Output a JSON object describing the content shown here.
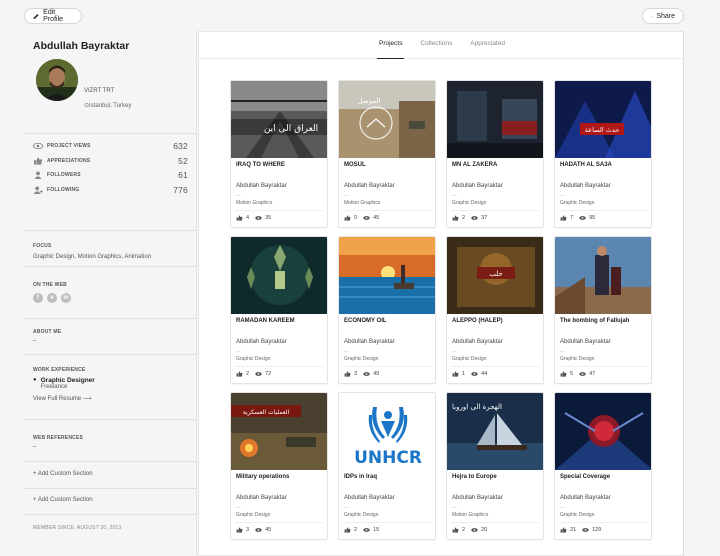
{
  "header": {
    "edit_label": "Edit Profile",
    "share_label": "Share"
  },
  "profile": {
    "name": "Abdullah Bayraktar",
    "organization": "VIZRT TRT",
    "location": "Istanbul, Turkey",
    "stats": [
      {
        "icon": "eye-icon",
        "label": "PROJECT VIEWS",
        "value": "632"
      },
      {
        "icon": "thumbs-up-icon",
        "label": "APPRECIATIONS",
        "value": "52"
      },
      {
        "icon": "person-icon",
        "label": "FOLLOWERS",
        "value": "61"
      },
      {
        "icon": "person-plus-icon",
        "label": "FOLLOWING",
        "value": "776"
      }
    ],
    "focus_title": "FOCUS",
    "focus_text": "Graphic Design, Motion Graphics, Animation",
    "web_title": "ON THE WEB",
    "social": [
      "f",
      "v",
      "in"
    ],
    "about_title": "ABOUT ME",
    "about_text": "–",
    "work_title": "WORK EXPERIENCE",
    "work_role": "Graphic Designer",
    "work_company": "Freelance",
    "resume_link": "View Full Resume",
    "refs_title": "WEB REFERENCES",
    "refs_text": "–",
    "custom_section_1": "+ Add Custom Section",
    "custom_section_2": "+ Add Custom Section",
    "member_since": "MEMBER SINCE: AUGUST 20, 2013"
  },
  "tabs": [
    "Projects",
    "Collections",
    "Appreciated"
  ],
  "projects": [
    {
      "title": "IRAQ TO WHERE",
      "owner": "Abdullah Bayraktar",
      "dash": "—",
      "field": "Motion Graphics",
      "likes": "4",
      "views": "35"
    },
    {
      "title": "MOSUL",
      "owner": "Abdullah Bayraktar",
      "dash": "—",
      "field": "Motion Graphics",
      "likes": "0",
      "views": "45"
    },
    {
      "title": "MN AL ZAKERA",
      "owner": "Abdullah Bayraktar",
      "dash": "—",
      "field": "Graphic Design",
      "likes": "2",
      "views": "37"
    },
    {
      "title": "HADATH AL SA3A",
      "owner": "Abdullah Bayraktar",
      "dash": "—",
      "field": "Graphic Design",
      "likes": "7",
      "views": "95"
    },
    {
      "title": "RAMADAN KAREEM",
      "owner": "Abdullah Bayraktar",
      "dash": "—",
      "field": "Graphic Design",
      "likes": "2",
      "views": "72"
    },
    {
      "title": "ECONOMY OIL",
      "owner": "Abdullah Bayraktar",
      "dash": "—",
      "field": "Graphic Design",
      "likes": "3",
      "views": "49"
    },
    {
      "title": "ALEPPO (HALEP)",
      "owner": "Abdullah Bayraktar",
      "dash": "—",
      "field": "Graphic Design",
      "likes": "1",
      "views": "44"
    },
    {
      "title": "The bombing of Fallujah",
      "owner": "Abdullah Bayraktar",
      "dash": "—",
      "field": "Graphic Design",
      "likes": "5",
      "views": "47"
    },
    {
      "title": "Military operations",
      "owner": "Abdullah Bayraktar",
      "dash": "—",
      "field": "Graphic Design",
      "likes": "3",
      "views": "45"
    },
    {
      "title": "IDPs in Iraq",
      "owner": "Abdullah Bayraktar",
      "dash": "—",
      "field": "Graphic Design",
      "likes": "2",
      "views": "15"
    },
    {
      "title": "Hejra to Europe",
      "owner": "Abdullah Bayraktar",
      "dash": "—",
      "field": "Motion Graphics",
      "likes": "2",
      "views": "20"
    },
    {
      "title": "Special Coverage",
      "owner": "Abdullah Bayraktar",
      "dash": "—",
      "field": "Graphic Design",
      "likes": "21",
      "views": "129"
    }
  ],
  "thumb_text": {
    "t1": "العراق الى اين",
    "t2": "الموصل",
    "t4": "حدث الساعة",
    "t7": "حلب",
    "t9": "العمليات العسكرية",
    "t10": "UNHCR",
    "t11": "الهجرة الى اوروبا"
  }
}
